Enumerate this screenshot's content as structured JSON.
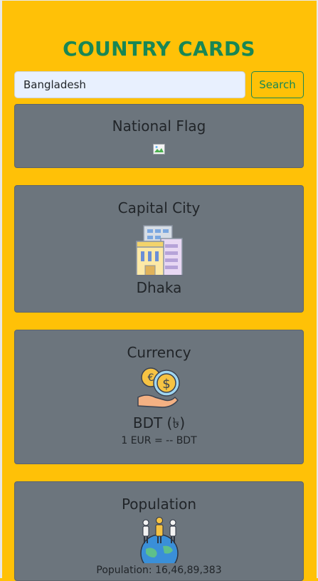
{
  "header": {
    "title": "COUNTRY CARDS"
  },
  "search": {
    "value": "Bangladesh",
    "button_label": "Search"
  },
  "cards": {
    "flag": {
      "title": "National Flag"
    },
    "capital": {
      "title": "Capital City",
      "value": "Dhaka",
      "icon": "buildings-icon"
    },
    "currency": {
      "title": "Currency",
      "value": "BDT (৳)",
      "rate": "1 EUR = -- BDT",
      "icon": "coins-hand-icon"
    },
    "population": {
      "title": "Population",
      "value": "Population: 16,46,89,383",
      "icon": "people-globe-icon"
    }
  },
  "colors": {
    "background": "#ffc107",
    "title": "#198754",
    "card": "#6c757d"
  }
}
